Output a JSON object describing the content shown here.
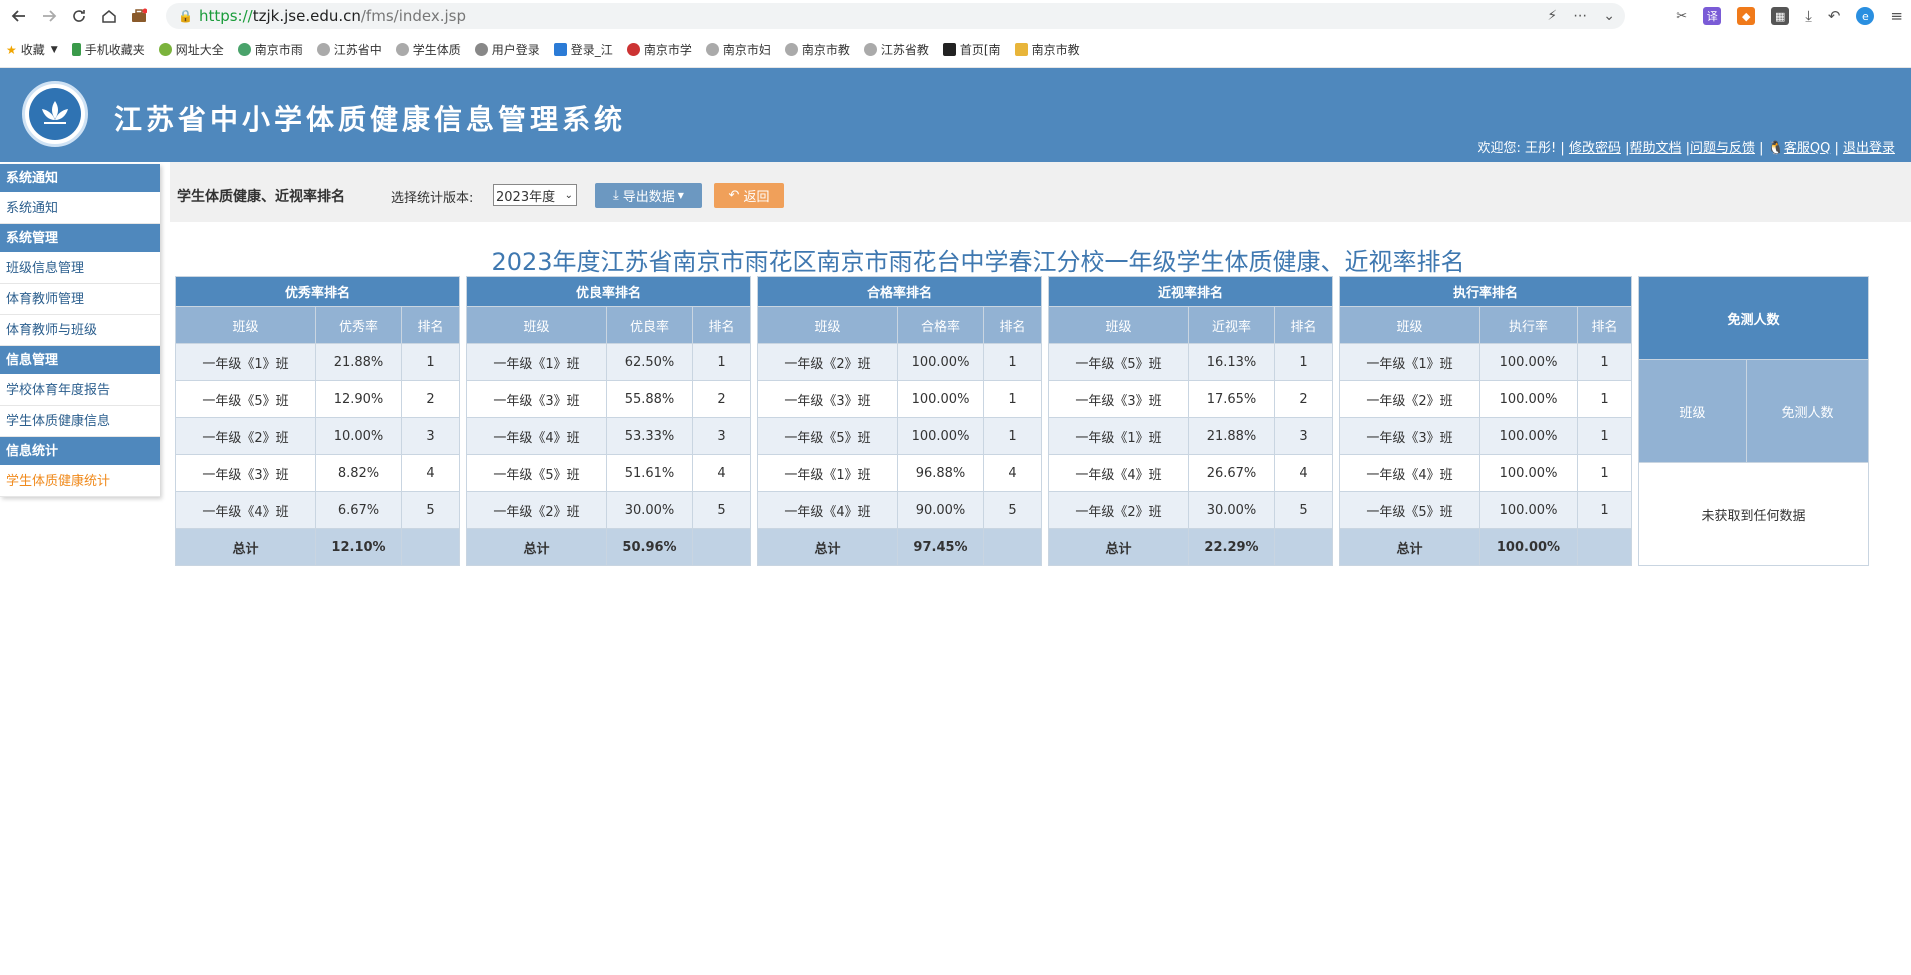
{
  "browser": {
    "url_protocol": "https://",
    "url_host": "tzjk.jse.edu.cn",
    "url_path": "/fms/index.jsp",
    "bookmarks": [
      "收藏",
      "手机收藏夹",
      "网址大全",
      "南京市雨",
      "江苏省中",
      "学生体质",
      "用户登录",
      "登录_江",
      "南京市学",
      "南京市妇",
      "南京市教",
      "江苏省教",
      "首页[南",
      "南京市教"
    ]
  },
  "header": {
    "system_title": "江苏省中小学体质健康信息管理系统",
    "welcome": "欢迎您: 王彤! |",
    "links": [
      "修改密码",
      "帮助文档",
      "问题与反馈",
      "客服QQ",
      "退出登录"
    ]
  },
  "sidebar": {
    "groups": [
      {
        "title": "系统通知",
        "items": [
          "系统通知"
        ]
      },
      {
        "title": "系统管理",
        "items": [
          "班级信息管理",
          "体育教师管理",
          "体育教师与班级"
        ]
      },
      {
        "title": "信息管理",
        "items": [
          "学校体育年度报告",
          "学生体质健康信息"
        ]
      },
      {
        "title": "信息统计",
        "items": [
          "学生体质健康统计"
        ]
      }
    ],
    "active_item": "学生体质健康统计"
  },
  "toolbar": {
    "page_title": "学生体质健康、近视率排名",
    "version_label": "选择统计版本:",
    "version_value": "2023年度",
    "export_label": "导出数据",
    "back_label": "返回"
  },
  "report_title": "2023年度江苏省南京市雨花区南京市雨花台中学春江分校一年级学生体质健康、近视率排名",
  "tables": [
    {
      "title": "优秀率排名",
      "cols": [
        "班级",
        "优秀率",
        "排名"
      ],
      "rows": [
        [
          "一年级《1》班",
          "21.88%",
          "1"
        ],
        [
          "一年级《5》班",
          "12.90%",
          "2"
        ],
        [
          "一年级《2》班",
          "10.00%",
          "3"
        ],
        [
          "一年级《3》班",
          "8.82%",
          "4"
        ],
        [
          "一年级《4》班",
          "6.67%",
          "5"
        ]
      ],
      "total_label": "总计",
      "total_value": "12.10%"
    },
    {
      "title": "优良率排名",
      "cols": [
        "班级",
        "优良率",
        "排名"
      ],
      "rows": [
        [
          "一年级《1》班",
          "62.50%",
          "1"
        ],
        [
          "一年级《3》班",
          "55.88%",
          "2"
        ],
        [
          "一年级《4》班",
          "53.33%",
          "3"
        ],
        [
          "一年级《5》班",
          "51.61%",
          "4"
        ],
        [
          "一年级《2》班",
          "30.00%",
          "5"
        ]
      ],
      "total_label": "总计",
      "total_value": "50.96%"
    },
    {
      "title": "合格率排名",
      "cols": [
        "班级",
        "合格率",
        "排名"
      ],
      "rows": [
        [
          "一年级《2》班",
          "100.00%",
          "1"
        ],
        [
          "一年级《3》班",
          "100.00%",
          "1"
        ],
        [
          "一年级《5》班",
          "100.00%",
          "1"
        ],
        [
          "一年级《1》班",
          "96.88%",
          "4"
        ],
        [
          "一年级《4》班",
          "90.00%",
          "5"
        ]
      ],
      "total_label": "总计",
      "total_value": "97.45%"
    },
    {
      "title": "近视率排名",
      "cols": [
        "班级",
        "近视率",
        "排名"
      ],
      "rows": [
        [
          "一年级《5》班",
          "16.13%",
          "1"
        ],
        [
          "一年级《3》班",
          "17.65%",
          "2"
        ],
        [
          "一年级《1》班",
          "21.88%",
          "3"
        ],
        [
          "一年级《4》班",
          "26.67%",
          "4"
        ],
        [
          "一年级《2》班",
          "30.00%",
          "5"
        ]
      ],
      "total_label": "总计",
      "total_value": "22.29%"
    },
    {
      "title": "执行率排名",
      "cols": [
        "班级",
        "执行率",
        "排名"
      ],
      "rows": [
        [
          "一年级《1》班",
          "100.00%",
          "1"
        ],
        [
          "一年级《2》班",
          "100.00%",
          "1"
        ],
        [
          "一年级《3》班",
          "100.00%",
          "1"
        ],
        [
          "一年级《4》班",
          "100.00%",
          "1"
        ],
        [
          "一年级《5》班",
          "100.00%",
          "1"
        ]
      ],
      "total_label": "总计",
      "total_value": "100.00%"
    }
  ],
  "exempt_table": {
    "title": "免测人数",
    "cols": [
      "班级",
      "免测人数"
    ],
    "empty": "未获取到任何数据"
  }
}
